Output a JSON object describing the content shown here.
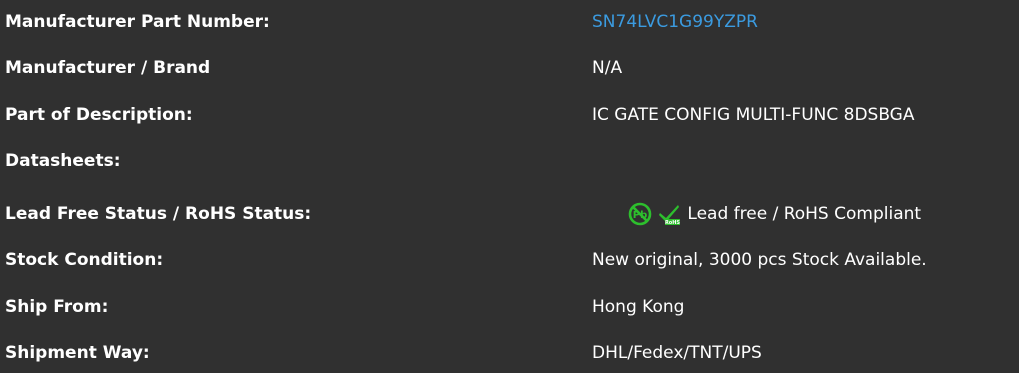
{
  "rows": [
    {
      "label": "Manufacturer Part Number:",
      "value": "SN74LVC1G99YZPR"
    },
    {
      "label": "Manufacturer / Brand",
      "value": "N/A"
    },
    {
      "label": "Part of Description:",
      "value": "IC GATE CONFIG MULTI-FUNC 8DSBGA"
    },
    {
      "label": "Datasheets:",
      "value": ""
    },
    {
      "label": "Lead Free Status / RoHS Status:",
      "value": "Lead free / RoHS Compliant"
    },
    {
      "label": "Stock Condition:",
      "value": "New original, 3000 pcs Stock Available."
    },
    {
      "label": "Ship From:",
      "value": "Hong Kong"
    },
    {
      "label": "Shipment Way:",
      "value": "DHL/Fedex/TNT/UPS"
    }
  ],
  "icons": {
    "lead_free": "lead-free-icon",
    "rohs": "rohs-check-icon",
    "rohs_text": "RoHS"
  },
  "colors": {
    "background": "#303030",
    "text": "#ffffff",
    "link": "#3b9be0",
    "icon_green": "#2dbf2d"
  }
}
